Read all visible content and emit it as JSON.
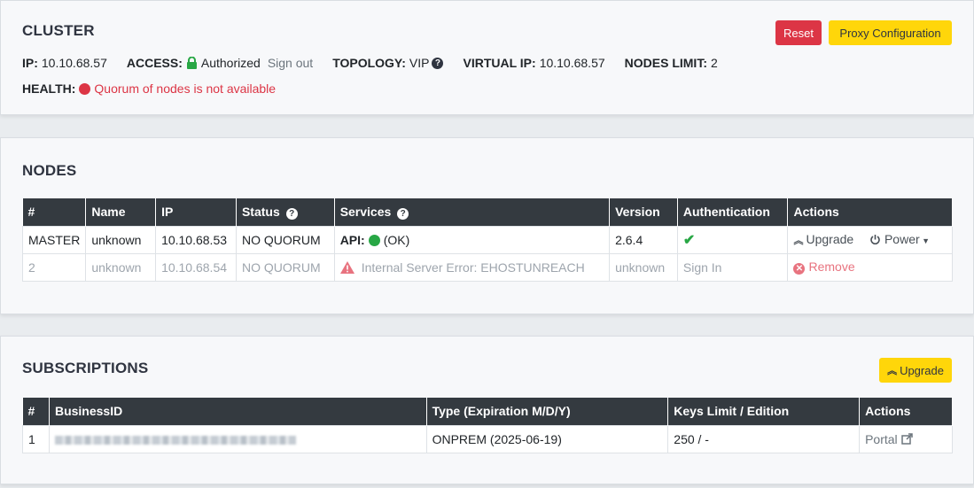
{
  "cluster": {
    "title": "CLUSTER",
    "reset_label": "Reset",
    "proxy_label": "Proxy Configuration",
    "ip_label": "IP:",
    "ip_value": "10.10.68.57",
    "access_label": "ACCESS:",
    "access_value": "Authorized",
    "signout_label": "Sign out",
    "topology_label": "TOPOLOGY:",
    "topology_value": "VIP",
    "vip_label": "VIRTUAL IP:",
    "vip_value": "10.10.68.57",
    "nodes_limit_label": "NODES LIMIT:",
    "nodes_limit_value": "2",
    "health_label": "HEALTH:",
    "health_value": "Quorum of nodes is not available"
  },
  "nodes": {
    "title": "NODES",
    "columns": [
      "#",
      "Name",
      "IP",
      "Status",
      "Services",
      "Version",
      "Authentication",
      "Actions"
    ],
    "rows": [
      {
        "num": "MASTER",
        "name": "unknown",
        "ip": "10.10.68.53",
        "status": "NO QUORUM",
        "service_label": "API:",
        "service_value": "(OK)",
        "version": "2.6.4",
        "upgrade_label": "Upgrade",
        "power_label": "Power"
      },
      {
        "num": "2",
        "name": "unknown",
        "ip": "10.10.68.54",
        "status": "NO QUORUM",
        "service_error": "Internal Server Error: EHOSTUNREACH",
        "version": "unknown",
        "auth": "Sign In",
        "remove_label": "Remove"
      }
    ]
  },
  "subscriptions": {
    "title": "SUBSCRIPTIONS",
    "upgrade_label": "Upgrade",
    "columns": [
      "#",
      "BusinessID",
      "Type (Expiration M/D/Y)",
      "Keys Limit / Edition",
      "Actions"
    ],
    "rows": [
      {
        "num": "1",
        "type": "ONPREM (2025-06-19)",
        "keys": "250 / -",
        "action": "Portal"
      }
    ]
  },
  "colors": {
    "danger": "#dc3545",
    "success": "#28a745",
    "warning": "#ffd60a",
    "header": "#343a40"
  },
  "icons": [
    "lock-icon",
    "question-circle-icon",
    "red-dot-icon",
    "green-dot-icon",
    "check-icon",
    "warning-triangle-icon",
    "angle-double-up-icon",
    "power-icon",
    "caret-down-icon",
    "times-circle-icon",
    "external-link-icon"
  ]
}
